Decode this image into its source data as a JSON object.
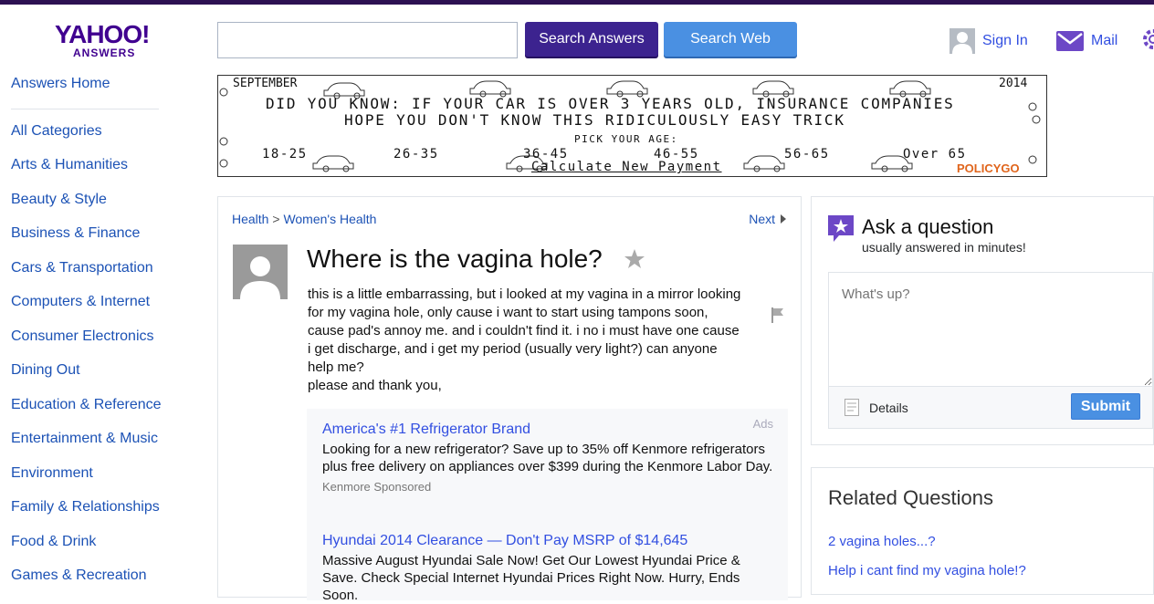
{
  "header": {
    "logo_brand": "YAHOO!",
    "logo_sub": "ANSWERS",
    "search_value": "",
    "search_answers_label": "Search Answers",
    "search_web_label": "Search Web",
    "signin_label": "Sign In",
    "mail_label": "Mail",
    "icons": [
      "user-icon",
      "mail-icon",
      "gear-icon"
    ]
  },
  "sidebar": {
    "home_label": "Answers Home",
    "categories": [
      "All Categories",
      "Arts & Humanities",
      "Beauty & Style",
      "Business & Finance",
      "Cars & Transportation",
      "Computers & Internet",
      "Consumer Electronics",
      "Dining Out",
      "Education & Reference",
      "Entertainment & Music",
      "Environment",
      "Family & Relationships",
      "Food & Drink",
      "Games & Recreation"
    ]
  },
  "banner": {
    "month": "SEPTEMBER",
    "year": "2014",
    "line1": "DID YOU KNOW:  IF YOUR CAR IS OVER 3 YEARS OLD, INSURANCE COMPANIES",
    "line2": "HOPE YOU DON'T KNOW THIS RIDICULOUSLY EASY TRICK",
    "pick_age": "PICK YOUR AGE:",
    "ages": [
      "18-25",
      "26-35",
      "36-45",
      "46-55",
      "56-65",
      "Over 65"
    ],
    "cta": "Calculate New Payment",
    "brand": "POLICYGO"
  },
  "question": {
    "breadcrumb_parent": "Health",
    "breadcrumb_sep": ">",
    "breadcrumb_child": "Women's Health",
    "next_label": "Next",
    "title": "Where is the vagina hole?",
    "body_line1": "this is a little embarrassing, but i looked at my vagina in a mirror looking for my vagina hole, only cause i want to start using tampons soon, cause pad's annoy me. and i couldn't find it. i no i must have one cause i get discharge, and i get my period (usually very light?) can anyone help me?",
    "body_line2": "please and thank you,"
  },
  "ads": {
    "label": "Ads",
    "items": [
      {
        "title": "America's #1 Refrigerator Brand",
        "desc": "Looking for a new refrigerator? Save up to 35% off Kenmore refrigerators plus free delivery on appliances over $399 during the Kenmore Labor Day.",
        "sponsor": "Kenmore Sponsored"
      },
      {
        "title": "Hyundai 2014 Clearance — Don't Pay MSRP of $14,645",
        "desc": "Massive August Hyundai Sale Now! Get Our Lowest Hyundai Price & Save. Check Special Internet Hyundai Prices Right Now. Hurry, Ends Soon."
      }
    ]
  },
  "ask": {
    "title": "Ask a question",
    "subtitle": "usually answered in minutes!",
    "placeholder": "What's up?",
    "details_label": "Details",
    "submit_label": "Submit"
  },
  "related": {
    "title": "Related Questions",
    "items": [
      "2 vagina holes...?",
      "Help i cant find my vagina hole!?"
    ]
  },
  "colors": {
    "brand_purple": "#400090",
    "link_blue": "#1c52b5",
    "search_answers_bg": "#3c238f",
    "search_web_bg": "#4a90e2"
  }
}
